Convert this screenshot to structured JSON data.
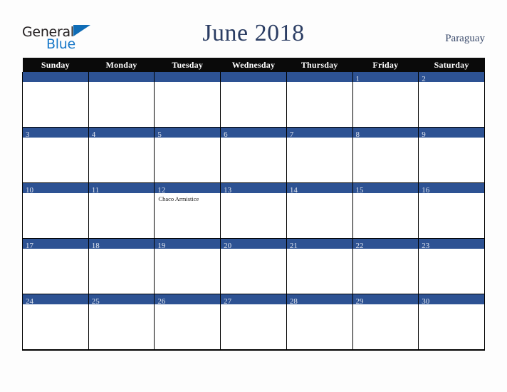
{
  "logo": {
    "text_primary": "General",
    "text_secondary": "Blue",
    "triangle_icon": "blue-triangle-icon",
    "colors": {
      "primary_text": "#231f20",
      "secondary_text": "#1878c8",
      "triangle": "#0f6cb6"
    }
  },
  "header": {
    "title": "June 2018",
    "region": "Paraguay",
    "title_color": "#2b3d63",
    "region_color": "#3a4a6b"
  },
  "calendar": {
    "month": "June",
    "year": "2018",
    "weekday_headers": [
      "Sunday",
      "Monday",
      "Tuesday",
      "Wednesday",
      "Thursday",
      "Friday",
      "Saturday"
    ],
    "colors": {
      "header_row_bg": "#0a0a0a",
      "header_row_text": "#ffffff",
      "day_bar_bg": "#2d5293",
      "day_number_text": "#dfe4ee",
      "cell_bg": "#ffffff",
      "grid_border": "#000000"
    },
    "weeks": [
      [
        {
          "day": "",
          "event": ""
        },
        {
          "day": "",
          "event": ""
        },
        {
          "day": "",
          "event": ""
        },
        {
          "day": "",
          "event": ""
        },
        {
          "day": "",
          "event": ""
        },
        {
          "day": "1",
          "event": ""
        },
        {
          "day": "2",
          "event": ""
        }
      ],
      [
        {
          "day": "3",
          "event": ""
        },
        {
          "day": "4",
          "event": ""
        },
        {
          "day": "5",
          "event": ""
        },
        {
          "day": "6",
          "event": ""
        },
        {
          "day": "7",
          "event": ""
        },
        {
          "day": "8",
          "event": ""
        },
        {
          "day": "9",
          "event": ""
        }
      ],
      [
        {
          "day": "10",
          "event": ""
        },
        {
          "day": "11",
          "event": ""
        },
        {
          "day": "12",
          "event": "Chaco Armistice"
        },
        {
          "day": "13",
          "event": ""
        },
        {
          "day": "14",
          "event": ""
        },
        {
          "day": "15",
          "event": ""
        },
        {
          "day": "16",
          "event": ""
        }
      ],
      [
        {
          "day": "17",
          "event": ""
        },
        {
          "day": "18",
          "event": ""
        },
        {
          "day": "19",
          "event": ""
        },
        {
          "day": "20",
          "event": ""
        },
        {
          "day": "21",
          "event": ""
        },
        {
          "day": "22",
          "event": ""
        },
        {
          "day": "23",
          "event": ""
        }
      ],
      [
        {
          "day": "24",
          "event": ""
        },
        {
          "day": "25",
          "event": ""
        },
        {
          "day": "26",
          "event": ""
        },
        {
          "day": "27",
          "event": ""
        },
        {
          "day": "28",
          "event": ""
        },
        {
          "day": "29",
          "event": ""
        },
        {
          "day": "30",
          "event": ""
        }
      ]
    ]
  }
}
